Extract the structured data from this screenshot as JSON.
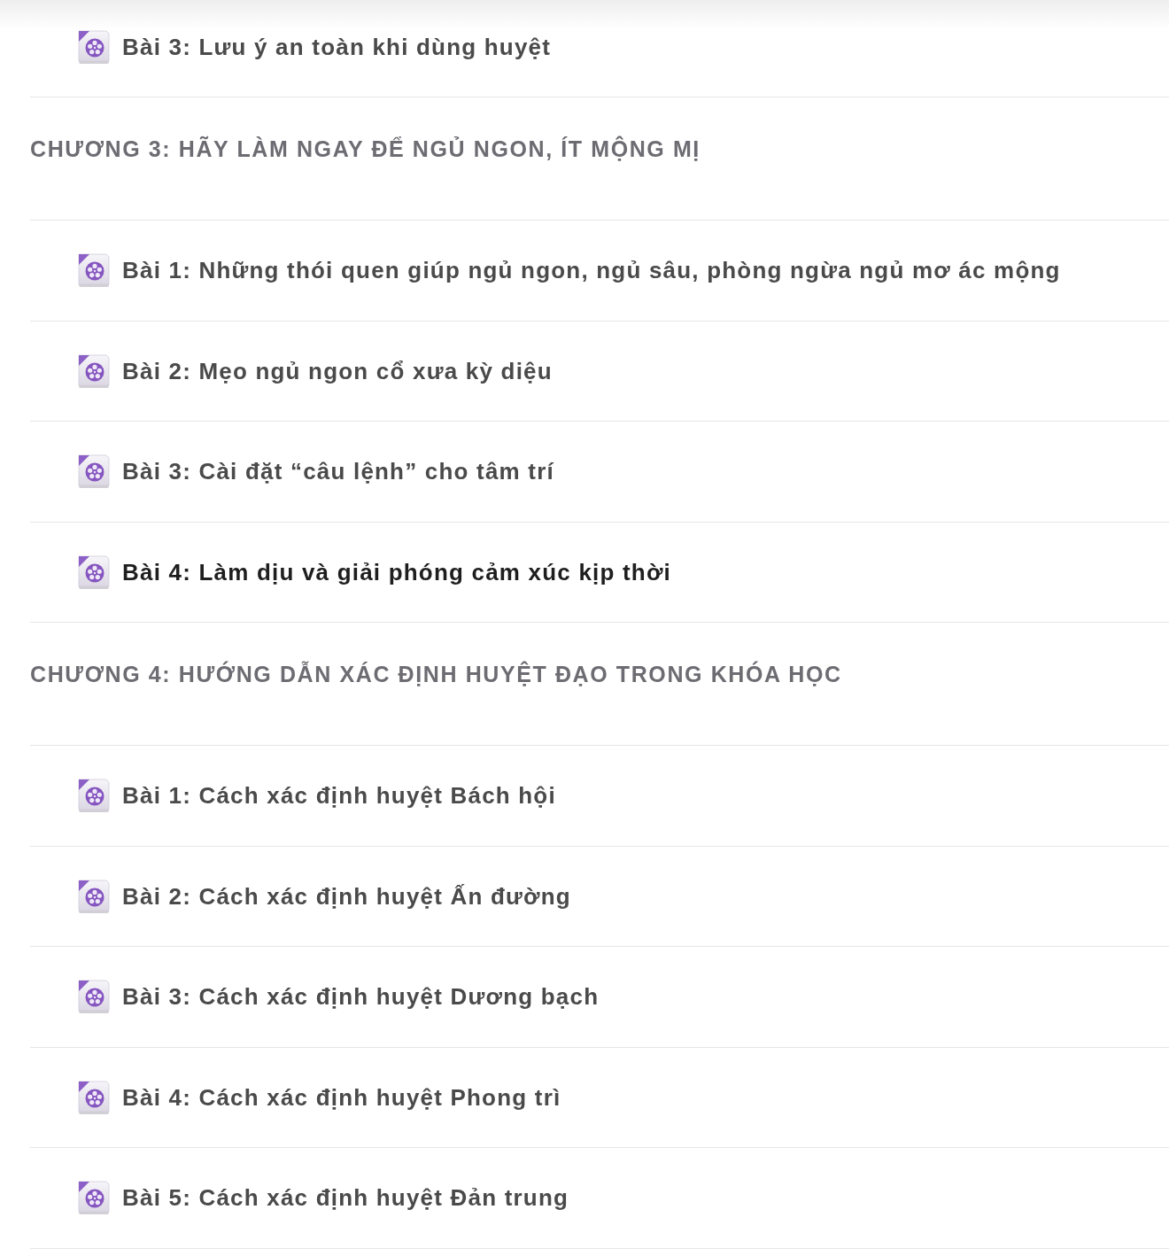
{
  "sections": [
    {
      "lessons": [
        {
          "title": "Bài 3: Lưu ý an toàn khi dùng huyệt",
          "selected": false
        }
      ]
    },
    {
      "heading": "CHƯƠNG 3: HÃY LÀM NGAY ĐỂ NGỦ NGON, ÍT MỘNG MỊ",
      "lessons": [
        {
          "title": "Bài 1: Những thói quen giúp ngủ ngon, ngủ sâu, phòng ngừa ngủ mơ ác mộng",
          "selected": false
        },
        {
          "title": "Bài 2: Mẹo ngủ ngon cổ xưa kỳ diệu",
          "selected": false
        },
        {
          "title": "Bài 3: Cài đặt “câu lệnh” cho tâm trí",
          "selected": false
        },
        {
          "title": "Bài 4: Làm dịu và giải phóng cảm xúc kịp thời",
          "selected": true
        }
      ]
    },
    {
      "heading": "CHƯƠNG 4: HƯỚNG DẪN XÁC ĐỊNH HUYỆT ĐẠO TRONG KHÓA HỌC",
      "lessons": [
        {
          "title": "Bài 1: Cách xác định huyệt Bách hội",
          "selected": false
        },
        {
          "title": "Bài 2: Cách xác định huyệt Ấn đường",
          "selected": false
        },
        {
          "title": "Bài 3: Cách xác định huyệt Dương bạch",
          "selected": false
        },
        {
          "title": "Bài 4: Cách xác định huyệt Phong trì",
          "selected": false
        },
        {
          "title": "Bài 5: Cách xác định huyệt Đản trung",
          "selected": false
        }
      ]
    }
  ]
}
